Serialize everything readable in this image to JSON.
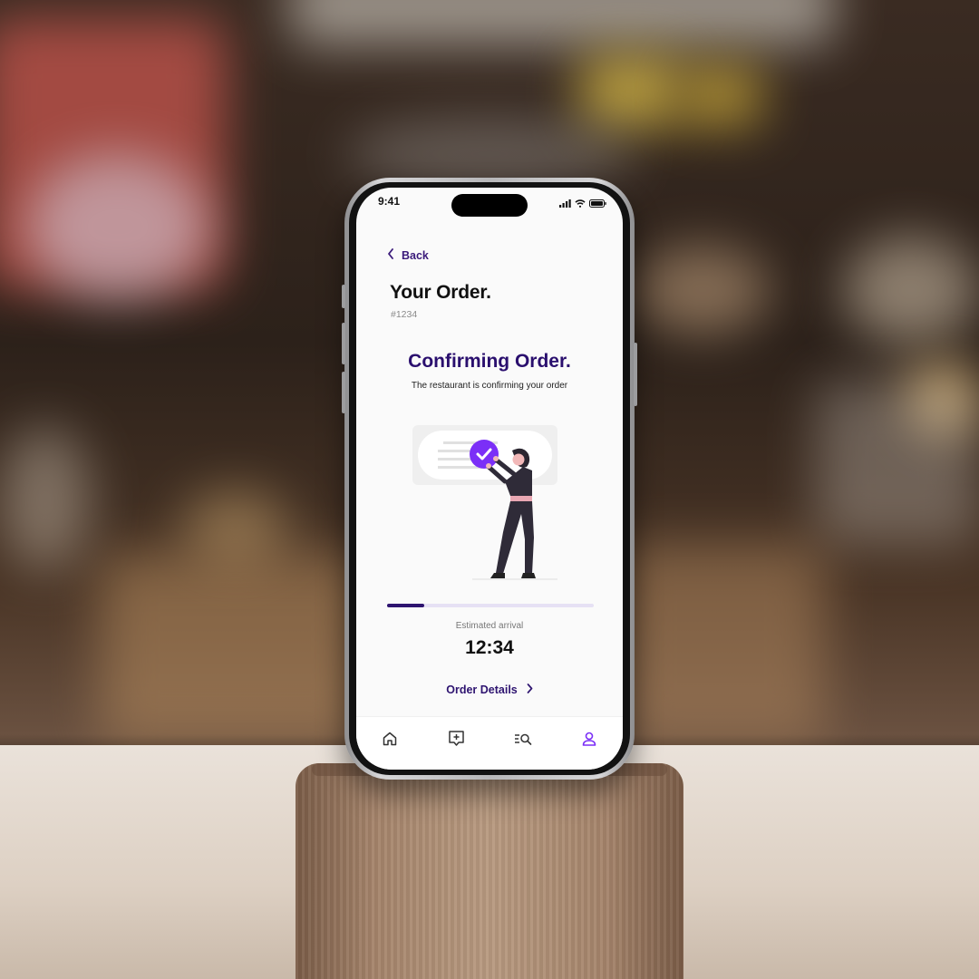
{
  "status_bar": {
    "time": "9:41",
    "icons": [
      "signal-icon",
      "wifi-icon",
      "battery-icon"
    ]
  },
  "header": {
    "back_label": "Back",
    "title": "Your Order.",
    "order_id": "#1234"
  },
  "order_status": {
    "title": "Confirming Order.",
    "subtitle": "The restaurant is confirming your order",
    "progress": 0.18
  },
  "arrival": {
    "label": "Estimated arrival",
    "time": "12:34"
  },
  "details_link": {
    "label": "Order Details"
  },
  "tabbar": {
    "items": [
      "home-icon",
      "new-order-icon",
      "search-list-icon",
      "profile-icon"
    ],
    "active": "profile-icon"
  },
  "colors": {
    "primary": "#2e1470",
    "accent": "#7b2ff7",
    "background": "#fafafa"
  }
}
